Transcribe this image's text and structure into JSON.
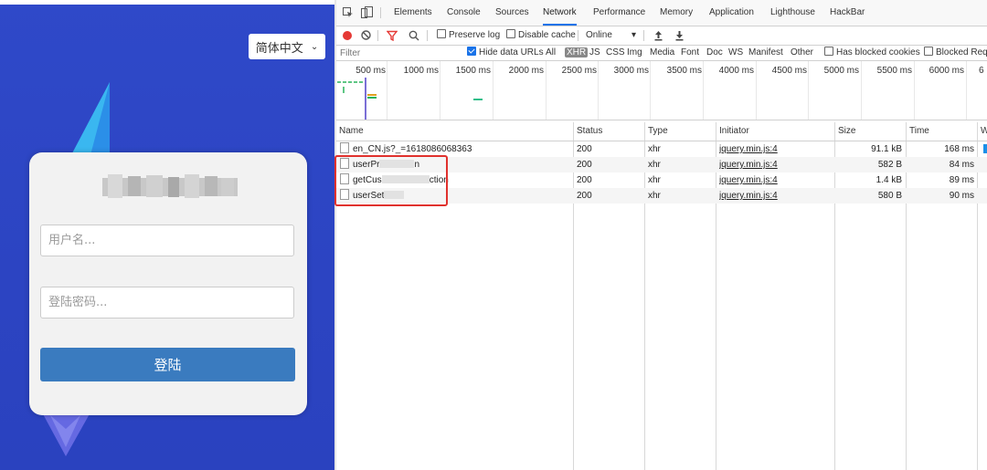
{
  "login": {
    "language": "简体中文",
    "username_placeholder": "用户名...",
    "password_placeholder": "登陆密码...",
    "login_button": "登陆"
  },
  "devtools": {
    "tabs": [
      "Elements",
      "Console",
      "Sources",
      "Network",
      "Performance",
      "Memory",
      "Application",
      "Lighthouse",
      "HackBar"
    ],
    "active_tab": "Network",
    "toolbar": {
      "preserve_log": "Preserve log",
      "disable_cache": "Disable cache",
      "throttle": "Online"
    },
    "filter": {
      "placeholder": "Filter",
      "hide_data_urls": "Hide data URLs",
      "types": [
        "All",
        "XHR",
        "JS",
        "CSS",
        "Img",
        "Media",
        "Font",
        "Doc",
        "WS",
        "Manifest",
        "Other"
      ],
      "active_type": "XHR",
      "has_blocked_cookies": "Has blocked cookies",
      "blocked_requests": "Blocked Requ"
    },
    "timeline_ticks": [
      "500 ms",
      "1000 ms",
      "1500 ms",
      "2000 ms",
      "2500 ms",
      "3000 ms",
      "3500 ms",
      "4000 ms",
      "4500 ms",
      "5000 ms",
      "5500 ms",
      "6000 ms",
      "6"
    ],
    "columns": [
      "Name",
      "Status",
      "Type",
      "Initiator",
      "Size",
      "Time",
      "W"
    ],
    "requests": [
      {
        "name_a": "en_CN.js?_=1618086068363",
        "name_b": "",
        "status": "200",
        "type": "xhr",
        "initiator": "jquery.min.js:4",
        "size": "91.1 kB",
        "time": "168 ms"
      },
      {
        "name_a": "userPr",
        "name_b": "n",
        "status": "200",
        "type": "xhr",
        "initiator": "jquery.min.js:4",
        "size": "582 B",
        "time": "84 ms"
      },
      {
        "name_a": "getCus",
        "name_b": "ction",
        "status": "200",
        "type": "xhr",
        "initiator": "jquery.min.js:4",
        "size": "1.4 kB",
        "time": "89 ms"
      },
      {
        "name_a": "userSet",
        "name_b": "",
        "status": "200",
        "type": "xhr",
        "initiator": "jquery.min.js:4",
        "size": "580 B",
        "time": "90 ms"
      }
    ]
  },
  "colors": {
    "login_bg": "#2f49c9",
    "login_button": "#3a7bbf",
    "highlight": "#e0312d",
    "record": "#e53935",
    "active_tab": "#1a73e8"
  }
}
